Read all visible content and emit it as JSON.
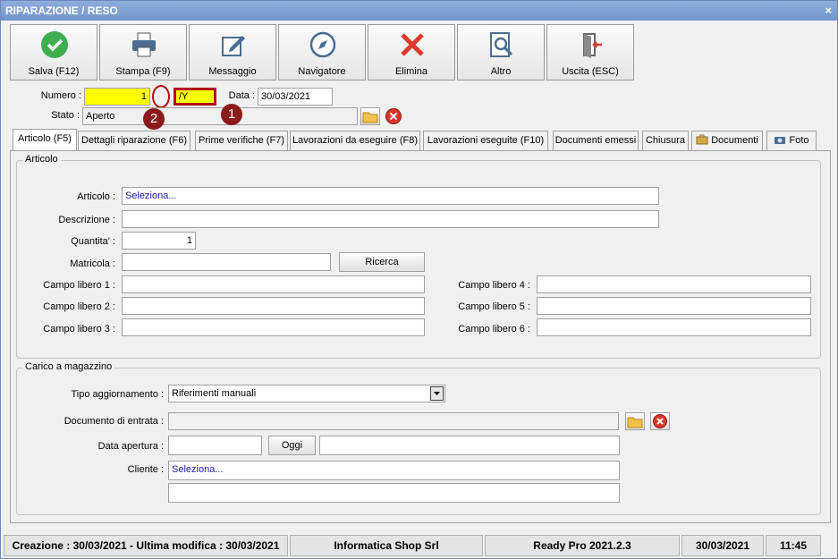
{
  "window": {
    "title": "RIPARAZIONE / RESO",
    "close_glyph": "×"
  },
  "toolbar": [
    {
      "label": "Salva (F12)",
      "icon": "check-icon"
    },
    {
      "label": "Stampa (F9)",
      "icon": "printer-icon"
    },
    {
      "label": "Messaggio",
      "icon": "message-icon"
    },
    {
      "label": "Navigatore",
      "icon": "compass-icon"
    },
    {
      "label": "Elimina",
      "icon": "delete-icon"
    },
    {
      "label": "Altro",
      "icon": "search-document-icon"
    },
    {
      "label": "Uscita (ESC)",
      "icon": "exit-door-icon"
    }
  ],
  "header": {
    "numero_label": "Numero :",
    "numero_value": "1",
    "serie_value": "/Y",
    "data_label": "Data :",
    "data_value": "30/03/2021",
    "stato_label": "Stato :",
    "stato_value": "Aperto"
  },
  "annotations": {
    "badge1": "1",
    "badge2": "2"
  },
  "tabs": [
    {
      "label": "Articolo (F5)"
    },
    {
      "label": "Dettagli riparazione (F6)"
    },
    {
      "label": "Prime verifiche (F7)"
    },
    {
      "label": "Lavorazioni da eseguire (F8)"
    },
    {
      "label": "Lavorazioni eseguite (F10)"
    },
    {
      "label": "Documenti emessi"
    },
    {
      "label": "Chiusura"
    },
    {
      "label": "Documenti"
    },
    {
      "label": "Foto"
    }
  ],
  "articolo": {
    "group_title": "Articolo",
    "articolo_label": "Articolo :",
    "articolo_value": "Seleziona...",
    "descrizione_label": "Descrizione :",
    "descrizione_value": "",
    "quantita_label": "Quantita' :",
    "quantita_value": "1",
    "matricola_label": "Matricola :",
    "matricola_value": "",
    "ricerca_label": "Ricerca",
    "campo1_label": "Campo libero 1 :",
    "campo2_label": "Campo libero 2 :",
    "campo3_label": "Campo libero 3 :",
    "campo4_label": "Campo libero 4 :",
    "campo5_label": "Campo libero 5 :",
    "campo6_label": "Campo libero 6 :"
  },
  "magazzino": {
    "group_title": "Carico a magazzino",
    "tipo_label": "Tipo aggiornamento :",
    "tipo_value": "Riferimenti manuali",
    "documento_label": "Documento di entrata :",
    "data_apertura_label": "Data apertura :",
    "oggi_label": "Oggi",
    "cliente_label": "Cliente :",
    "cliente_value": "Seleziona..."
  },
  "statusbar": {
    "dates": "Creazione : 30/03/2021 - Ultima modifica : 30/03/2021",
    "company": "Informatica Shop Srl",
    "version": "Ready Pro 2021.2.3",
    "date": "30/03/2021",
    "time": "11:45"
  },
  "colors": {
    "title_bar": "#7f9fd3",
    "highlight_yellow": "#ffff00",
    "annotation_red": "#8b1a1a",
    "select_blue": "#1a1aaa"
  }
}
